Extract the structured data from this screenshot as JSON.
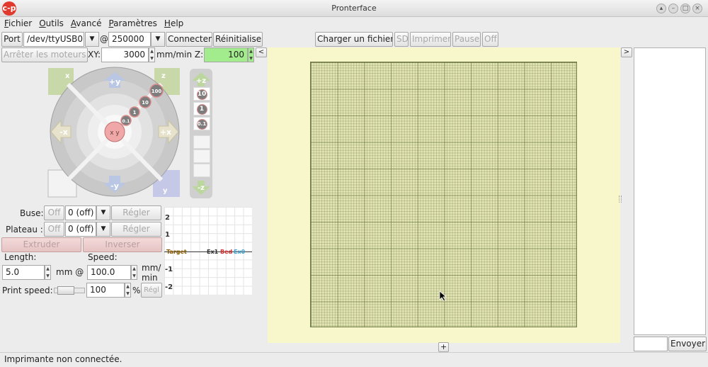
{
  "window": {
    "title": "Pronterface",
    "app_icon_glyph": "c-p"
  },
  "menu": [
    {
      "access_key": "F",
      "rest": "ichier"
    },
    {
      "access_key": "O",
      "rest": "utils"
    },
    {
      "access_key": "A",
      "rest": "vancé"
    },
    {
      "access_key": "P",
      "rest": "aramètres"
    },
    {
      "access_key": "H",
      "rest": "elp"
    }
  ],
  "toolbar": {
    "port_label": "Port",
    "port_value": "/dev/ttyUSB0",
    "at_label": "@",
    "baud_value": "250000",
    "connect_label": "Connecter",
    "reset_label": "Réinitialiser",
    "load_file_label": "Charger un fichier",
    "sd_label": "SD",
    "print_label": "Imprimer",
    "pause_label": "Pause",
    "off_label": "Off"
  },
  "motors": {
    "stop_label": "Arrêter les moteurs",
    "xy_label": "XY:",
    "xy_speed": "3000",
    "units_label": "mm/min Z:",
    "z_speed": "100",
    "collapse_left": "<"
  },
  "jog": {
    "y_plus": "+y",
    "y_minus": "-y",
    "x_plus": "+x",
    "x_minus": "-x",
    "z_plus": "+z",
    "z_minus": "-z",
    "home_x_label": "x",
    "home_z_label": "z",
    "home_y_label": "y",
    "steps": [
      "100",
      "10",
      "1",
      "0.1"
    ],
    "z_steps": [
      "10",
      "1",
      "0.1"
    ],
    "center_label": "x y"
  },
  "temps": {
    "hotend_label": "Buse:",
    "bed_label": "Plateau :",
    "off_label": "Off",
    "hotend_value": "0 (off)",
    "bed_value": "0 (off)",
    "set_label": "Régler"
  },
  "extrude": {
    "extrude_label": "Extruder",
    "reverse_label": "Inverser",
    "length_label": "Length:",
    "speed_label": "Speed:",
    "length_value": "5.0",
    "length_unit": "mm @",
    "speed_value": "100.0",
    "speed_unit_1": "mm/",
    "speed_unit_2": "min",
    "print_speed_label": "Print speed:",
    "print_speed_value": "100",
    "percent": "%",
    "set_short": "Régl"
  },
  "graph": {
    "y_ticks": [
      "2",
      "1",
      "-1",
      "-2"
    ],
    "legend": [
      {
        "text": "Target",
        "color": "#8a5a00"
      },
      {
        "text": "Ex1",
        "color": "#333333"
      },
      {
        "text": "Bed",
        "color": "#d03030"
      },
      {
        "text": "Ex0",
        "color": "#3aa0d0"
      }
    ]
  },
  "right_panel": {
    "expand_label": ">",
    "send_label": "Envoyer",
    "command_value": ""
  },
  "bottom": {
    "add_label": "+",
    "status_text": "Imprimante non connectée."
  }
}
